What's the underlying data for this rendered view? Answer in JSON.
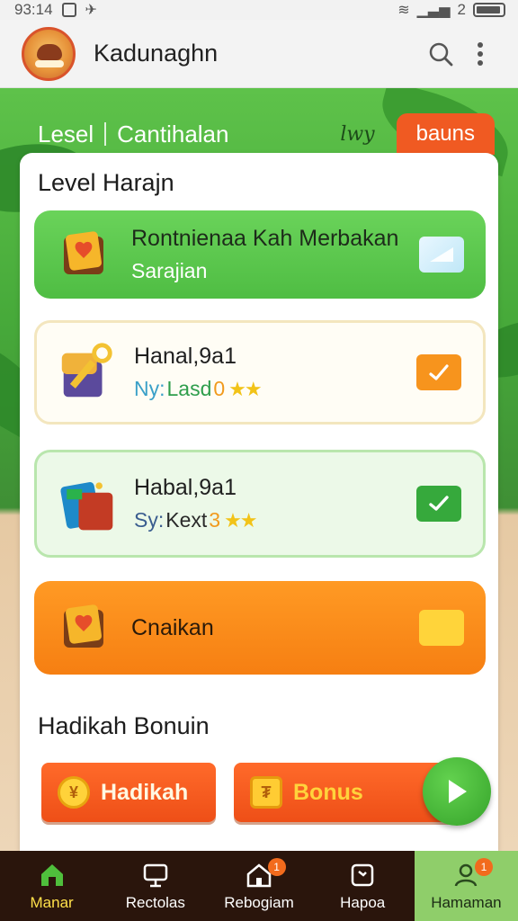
{
  "status_bar": {
    "time": "93:14",
    "signal_text": "2"
  },
  "app_bar": {
    "title": "Kadunaghn",
    "icons": [
      "app-logo",
      "search-icon",
      "more-vert-icon"
    ]
  },
  "tabs": {
    "left_1": "Lesel",
    "left_2": "Cantihalan",
    "right_italic": "lwy",
    "bonus": "bauns"
  },
  "level_section": {
    "title": "Level Harajn",
    "rows": [
      {
        "title": "Rontnienaa Kah Merbakan",
        "subtitle": "Sarajian",
        "icon": "chest-icon",
        "check": "check-light"
      },
      {
        "title": "Hanal,9a1",
        "sub_prefix": "Ny:",
        "sub_mid": "Lasd",
        "sub_num": "0",
        "stars": "★★",
        "icon": "scroll-key-icon",
        "check": "check-orange"
      },
      {
        "title": "Habal,9a1",
        "sub_prefix": "Sy:",
        "sub_mid": "Kext",
        "sub_num": "3",
        "stars": "★★",
        "icon": "books-icon",
        "check": "check-green"
      },
      {
        "title": "Cnaikan",
        "icon": "chest-icon",
        "check": "check-yellow"
      }
    ]
  },
  "bonus_section": {
    "title": "Hadikah Bonuin",
    "buttons": [
      {
        "label": "Hadikah",
        "icon": "coin-icon",
        "icon_glyph": "¥"
      },
      {
        "label": "Bonus",
        "icon": "bill-icon",
        "icon_glyph": "₮"
      }
    ]
  },
  "bottom_nav": [
    {
      "label": "Manar",
      "icon": "home-icon",
      "active": true
    },
    {
      "label": "Rectolas",
      "icon": "monitor-icon"
    },
    {
      "label": "Rebogiam",
      "icon": "house-icon",
      "badge": "1"
    },
    {
      "label": "Hapoa",
      "icon": "clock-icon"
    },
    {
      "label": "Hamaman",
      "icon": "profile-icon",
      "badge": "1",
      "selected": true
    }
  ],
  "colors": {
    "green": "#4fbd43",
    "orange": "#f67f12",
    "brand_red": "#ee4f17",
    "nav_bg": "#2a150c"
  }
}
